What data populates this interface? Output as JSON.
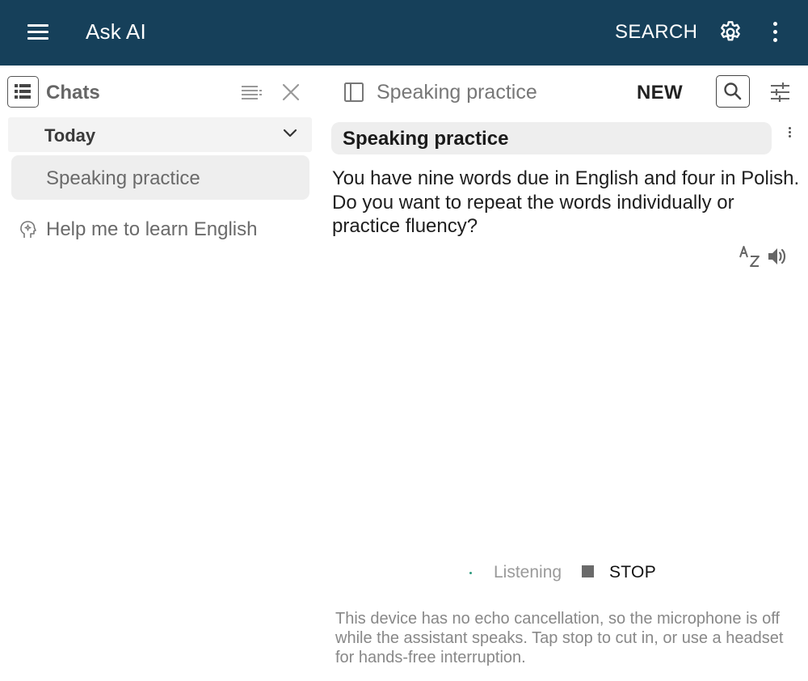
{
  "appbar": {
    "title": "Ask AI",
    "search_label": "SEARCH",
    "icons": [
      "menu-icon",
      "gear-icon",
      "more-vert-icon"
    ],
    "background": "#16405a"
  },
  "sidebar": {
    "header_label": "Chats",
    "section_label": "Today",
    "items": [
      {
        "label": "Speaking practice",
        "selected": true
      },
      {
        "label": "Help me to learn English",
        "icon": "brain-sparkle-icon"
      }
    ]
  },
  "chat": {
    "title": "Speaking practice",
    "new_label": "NEW",
    "message": {
      "header": "Speaking practice",
      "body": "You have nine words due in English and four in Polish. Do you want to repeat the words individually or practice fluency?"
    },
    "status_label": "Listening",
    "stop_label": "STOP",
    "notice": "This device has no echo cancellation, so the microphone is off while the assistant speaks. Tap stop to cut in, or use a headset for hands-free interruption."
  }
}
